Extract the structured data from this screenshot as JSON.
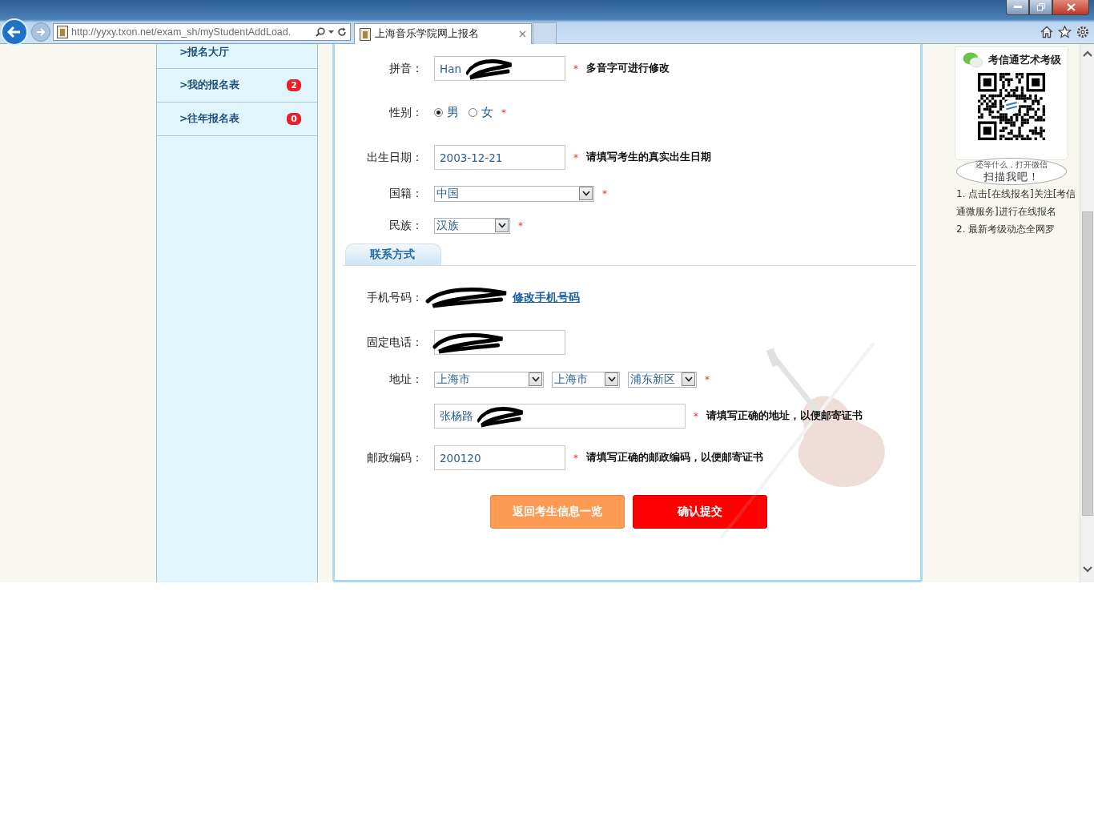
{
  "browser": {
    "address": "http://yyxy.txon.net/exam_sh/myStudentAddLoad.",
    "tabs": [
      {
        "title": "上海音乐学院网上报名",
        "selected": true
      }
    ]
  },
  "sidebar": {
    "items": [
      {
        "label": ">报名大厅"
      },
      {
        "label": ">我的报名表",
        "badge": "2"
      },
      {
        "label": ">往年报名表",
        "badge": "0"
      }
    ]
  },
  "form": {
    "rows": [
      {
        "kind": "text",
        "label": "拼音：",
        "value": "Han",
        "redacted": true,
        "required_mark": "*",
        "hint": "多音字可进行修改"
      },
      {
        "kind": "radio",
        "label": "性别：",
        "options": [
          {
            "label": "男",
            "selected": true
          },
          {
            "label": "女",
            "selected": false
          }
        ],
        "required_mark": "*"
      },
      {
        "kind": "text",
        "label": "出生日期：",
        "value": "2003-12-21",
        "required_mark": "*",
        "hint": "请填写考生的真实出生日期"
      },
      {
        "kind": "select",
        "label": "国籍：",
        "selects": [
          "中国"
        ],
        "required_mark": "*"
      },
      {
        "kind": "select",
        "label": "民族：",
        "selects": [
          "汉族"
        ],
        "required_mark": "*"
      },
      {
        "kind": "section",
        "label": "联系方式"
      },
      {
        "kind": "static",
        "label": "手机号码：",
        "redacted": true,
        "link": "修改手机号码"
      },
      {
        "kind": "text",
        "label": "固定电话：",
        "redacted": true
      },
      {
        "kind": "select",
        "label": "地址：",
        "selects": [
          "上海市",
          "上海市",
          "浦东新区"
        ],
        "required_mark": "*"
      },
      {
        "kind": "wide",
        "value": "张杨路",
        "redacted": true,
        "required_mark": "*",
        "hint": "请填写正确的地址，以便邮寄证书"
      },
      {
        "kind": "text",
        "label": "邮政编码：",
        "value": "200120",
        "required_mark": "*",
        "hint": "请填写正确的邮政编码，以便邮寄证书"
      }
    ],
    "buttons": [
      {
        "label": "返回考生信息一览",
        "kind": "secondary"
      },
      {
        "label": "确认提交",
        "kind": "primary"
      }
    ]
  },
  "promo": {
    "title": "考信通艺术考级",
    "bubble": [
      "还等什么，打开微信",
      "扫描我吧！"
    ],
    "notes": [
      "1. 点击[在线报名]关注[考信通微服务]进行在线报名",
      "2. 最新考级动态全网罗"
    ]
  }
}
